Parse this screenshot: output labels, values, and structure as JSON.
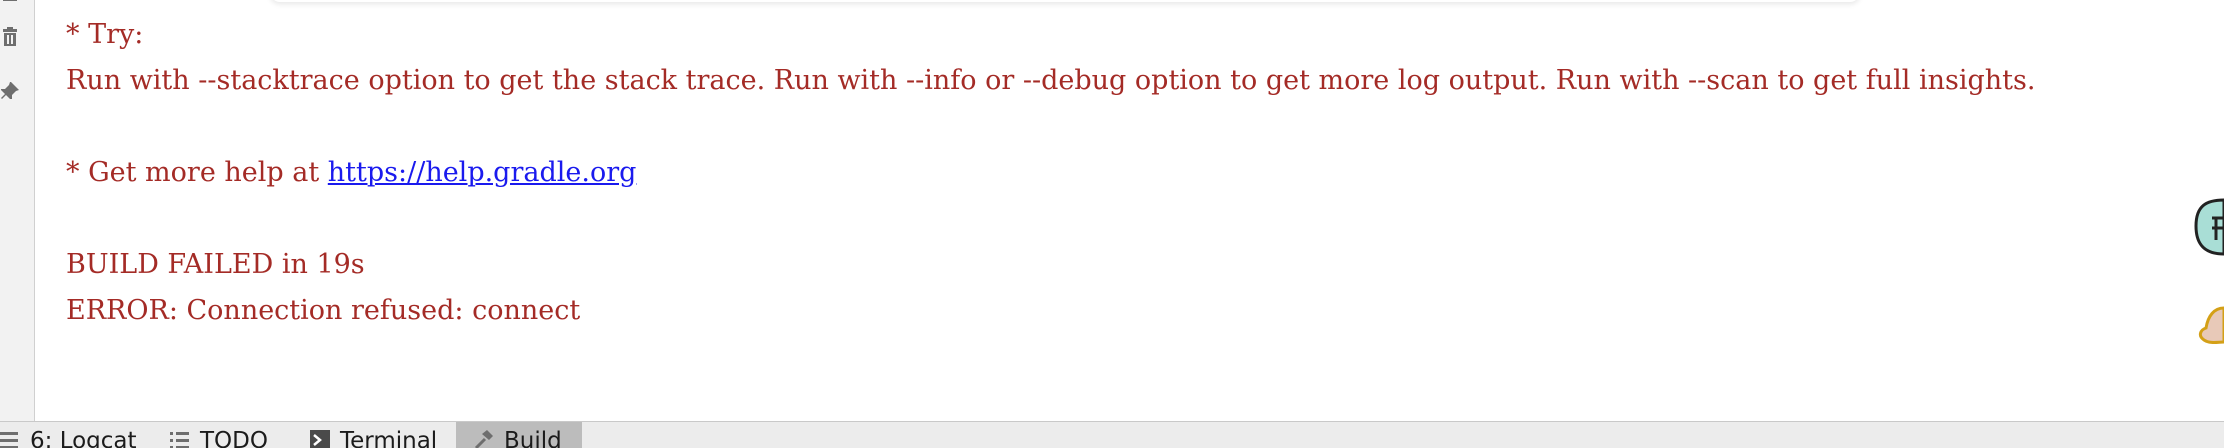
{
  "console": {
    "lines": [
      {
        "text": "* Try:"
      },
      {
        "text": "Run with --stacktrace option to get the stack trace. Run with --info or --debug option to get more log output. Run with --scan to get full insights."
      },
      {
        "text": ""
      },
      {
        "prefix": "* Get more help at ",
        "link": "https://help.gradle.org"
      },
      {
        "text": ""
      },
      {
        "text": "BUILD FAILED in 19s"
      },
      {
        "text": "ERROR: Connection refused: connect"
      }
    ]
  },
  "gutter": {
    "icons": [
      "collapse-icon",
      "trash-icon",
      "pin-icon"
    ]
  },
  "bottom_bar": {
    "tabs": [
      {
        "label": "6: Logcat",
        "icon": "list-icon",
        "active": false
      },
      {
        "label": "TODO",
        "icon": "checklist-icon",
        "active": false
      },
      {
        "label": "Terminal",
        "icon": "terminal-icon",
        "active": false
      },
      {
        "label": "Build",
        "icon": "hammer-icon",
        "active": true
      }
    ]
  },
  "colors": {
    "console_text": "#a42b26",
    "link": "#1a1aee",
    "active_tab": "#bcbcbc"
  }
}
